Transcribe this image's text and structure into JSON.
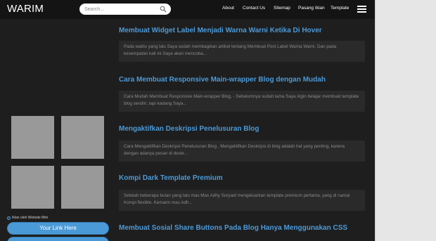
{
  "header": {
    "logo": "WARIM",
    "search": {
      "placeholder": "Search..."
    },
    "nav": [
      "About",
      "Contact Us",
      "Sitemap",
      "Pasang Iklan",
      "Template"
    ]
  },
  "sidebar": {
    "ad_label": "Iklan oleh Website Mini",
    "buttons": [
      "Your Link Here",
      ""
    ]
  },
  "posts": [
    {
      "title": "Membuat Widget Label Menjadi Warna Warni Ketika Di Hover",
      "snippet": "Pada waktu yang lalu Saya sudah membagikan artikel tentang Membuat Post Label Warna Warni. Dan pada kesempatan kali ini Saya akan mencoba..."
    },
    {
      "title": "Cara Membuat Responsive Main-wrapper Blog dengan Mudah",
      "snippet": "Cara Mudah Membuat Responsive Main-wrapper Blog, - Sebelumnya sudah lama Saya ingin belajar membuat template blog sendiri, tapi kadang Saya..."
    },
    {
      "title": "Mengaktifkan Deskripsi Penelusuran Blog",
      "snippet": "Cara Mengaktifkan Deskripsi Penelusuran Blog , Mengaktifkan Deskripsi di blog adalah hal yang penting, karena dengan adanya pesan di deskr..."
    },
    {
      "title": "Kompi Dark Template Premium",
      "snippet": "Setelah beberapa bulan yang lalu mas Mas Adhy Suryadi mengeluarkan template premium pertama, yang di namai Kompi flexible. Kemarin mas Adh..."
    },
    {
      "title": "Membuat Sosial Share Buttons Pada Blog Hanya Menggunakan CSS",
      "snippet": ""
    }
  ]
}
